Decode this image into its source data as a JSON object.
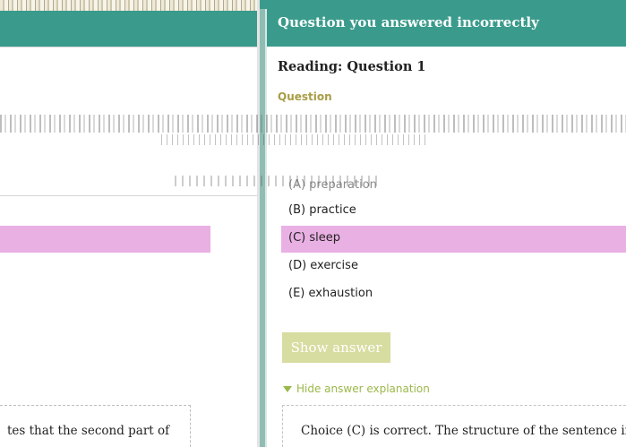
{
  "header": {
    "title": "Question you answered incorrectly"
  },
  "question": {
    "heading": "Reading: Question 1",
    "sublabel": "Question"
  },
  "choices": [
    {
      "label": "(A) preparation"
    },
    {
      "label": "(B) practice"
    },
    {
      "label": "(C) sleep"
    },
    {
      "label": "(D) exercise"
    },
    {
      "label": "(E) exhaustion"
    }
  ],
  "selected_choice_index": 2,
  "buttons": {
    "show_answer": "Show answer"
  },
  "toggle": {
    "hide_explanation": "Hide answer explanation"
  },
  "explanation": {
    "text": "Choice (C) is correct. The structure of the sentence indicates that the second part of"
  },
  "left_panel": {
    "explanation_text": "tes that the second part of"
  },
  "colors": {
    "header_teal": "#3a9b8c",
    "selected_pink": "#e9b0e4",
    "button_olive": "#d7dda0",
    "link_green": "#9bb84a",
    "sublabel_gold": "#a89d45"
  }
}
